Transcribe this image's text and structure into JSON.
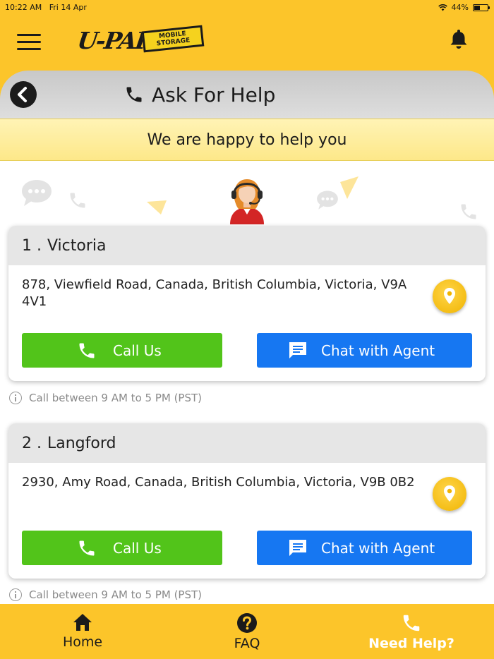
{
  "status_bar": {
    "time": "10:22 AM",
    "date": "Fri 14 Apr",
    "battery": "44%"
  },
  "header": {
    "logo_text": "U-PAK",
    "logo_tag_line1": "MOBILE",
    "logo_tag_line2": "STORAGE"
  },
  "page": {
    "title": "Ask For Help",
    "banner": "We are happy to help you"
  },
  "locations": [
    {
      "number": "1 .",
      "name": "Victoria",
      "address": "878, Viewfield Road, Canada, British Columbia, Victoria, V9A 4V1",
      "call_label": "Call Us",
      "chat_label": "Chat with Agent",
      "hours": "Call between 9 AM to 5 PM (PST)"
    },
    {
      "number": "2 .",
      "name": "Langford",
      "address": "2930, Amy Road, Canada, British Columbia, Victoria, V9B 0B2",
      "call_label": "Call Us",
      "chat_label": "Chat with Agent",
      "hours": "Call between 9 AM to 5 PM (PST)"
    }
  ],
  "tabbar": {
    "home": "Home",
    "faq": "FAQ",
    "help": "Need Help?",
    "active": "help"
  },
  "colors": {
    "brand_yellow": "#fcc52a",
    "call_green": "#52c41a",
    "chat_blue": "#1677f2"
  }
}
